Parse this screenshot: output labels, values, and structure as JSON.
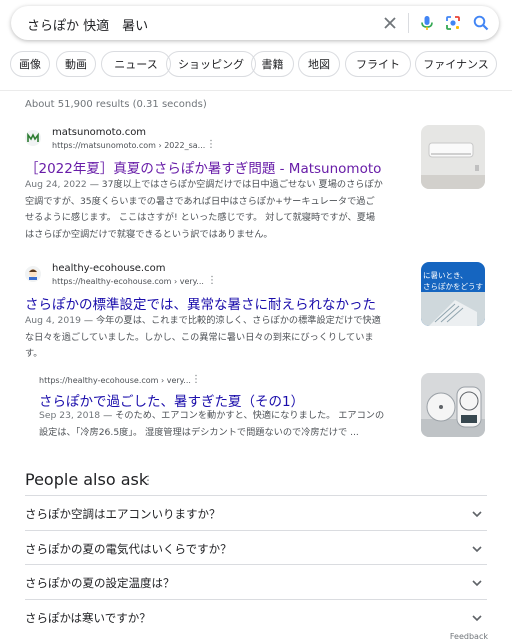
{
  "search": {
    "query": "さらぽか 快適　暑い"
  },
  "chips": [
    "画像",
    "動画",
    "ニュース",
    "ショッピング",
    "書籍",
    "地図",
    "フライト",
    "ファイナンス"
  ],
  "stats": "About 51,900 results (0.31 seconds)",
  "results": [
    {
      "site": "matsunomoto.com",
      "url": "https://matsunomoto.com › 2022_sa...",
      "title": "［2022年夏］真夏のさらぽか暑すぎ問題 - Matsunomoto",
      "date": "Aug 24, 2022",
      "snippet_lines": [
        " — 37度以上ではさらぽか空調だけでは日中過ごせない 夏場のさらぽか",
        "空調ですが、35度くらいまでの暑さであれば日中はさらぽか+サーキュレータで過ご",
        "せるように感じます。 ここはさすが! といった感じです。 対して就寝時ですが、夏場",
        "はさらぽか空調だけで就寝できるという訳ではありません。"
      ]
    },
    {
      "site": "healthy-ecohouse.com",
      "url": "https://healthy-ecohouse.com › very...",
      "title": "さらぽかの標準設定では、異常な暑さに耐えられなかった",
      "date": "Aug 4, 2019",
      "thumb_text": [
        "に暑いとき、",
        "さらぽかをどうす"
      ],
      "snippet_lines": [
        " — 今年の夏は、これまで比較的涼しく、さらぽかの標準設定だけで快適",
        "な日々を過ごしていました。しかし、この異常に暑い日々の到来にびっくりしていま",
        "す。"
      ]
    },
    {
      "site": "",
      "url": "https://healthy-ecohouse.com › very...",
      "title": "さらぽかで過ごした、暑すぎた夏（その1）",
      "date": "Sep 23, 2018",
      "snippet_lines": [
        " — そのため、エアコンを動かすと、快適になりました。 エアコンの",
        "設定は、「冷房26.5度」。 湿度管理はデシカントで問題ないので冷房だけで ..."
      ]
    }
  ],
  "paa": {
    "title": "People also ask",
    "questions": [
      "さらぽか空調はエアコンいりますか？",
      "さらぽかの夏の電気代はいくらですか？",
      "さらぽかの夏の設定温度は？",
      "さらぽかは寒いですか？"
    ]
  },
  "feedback": "Feedback",
  "colors": {
    "link": "#1a0dab",
    "visited": "#681da8",
    "text": "#4d5156"
  }
}
